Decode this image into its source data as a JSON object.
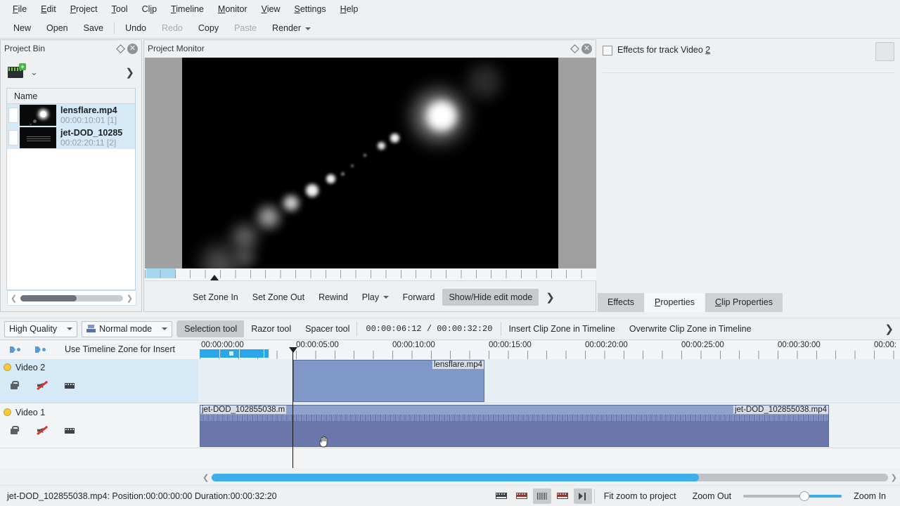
{
  "menubar": {
    "items": [
      {
        "label": "File",
        "accel": "F"
      },
      {
        "label": "Edit",
        "accel": "E"
      },
      {
        "label": "Project",
        "accel": "P"
      },
      {
        "label": "Tool",
        "accel": "T"
      },
      {
        "label": "Clip",
        "accel": "i"
      },
      {
        "label": "Timeline",
        "accel": "T"
      },
      {
        "label": "Monitor",
        "accel": "M"
      },
      {
        "label": "View",
        "accel": "V"
      },
      {
        "label": "Settings",
        "accel": "S"
      },
      {
        "label": "Help",
        "accel": "H"
      }
    ]
  },
  "toolbar": {
    "new_label": "New",
    "open_label": "Open",
    "save_label": "Save",
    "undo_label": "Undo",
    "redo_label": "Redo",
    "copy_label": "Copy",
    "paste_label": "Paste",
    "render_label": "Render"
  },
  "project_bin": {
    "title": "Project Bin",
    "column_header": "Name",
    "items": [
      {
        "name": "lensflare.mp4",
        "duration": "00:00:10:01 [1]"
      },
      {
        "name": "jet-DOD_10285",
        "duration": "00:02:20:11 [2]"
      }
    ]
  },
  "monitor": {
    "title": "Project Monitor",
    "buttons": [
      {
        "label": "Set Zone In",
        "pressed": false
      },
      {
        "label": "Set Zone Out",
        "pressed": false
      },
      {
        "label": "Rewind",
        "pressed": false
      },
      {
        "label": "Play",
        "pressed": false
      },
      {
        "label": "Forward",
        "pressed": false
      },
      {
        "label": "Show/Hide edit mode",
        "pressed": true
      }
    ]
  },
  "effects_panel": {
    "header": "Effects for track Video 2",
    "tabs": [
      {
        "label": "Effects",
        "active": false
      },
      {
        "label": "Properties",
        "active": true
      },
      {
        "label": "Clip Properties",
        "active": false
      }
    ]
  },
  "timeline_toolbar": {
    "quality": "High Quality",
    "mode": "Normal mode",
    "tools": [
      {
        "label": "Selection tool",
        "pressed": true
      },
      {
        "label": "Razor tool",
        "pressed": false
      },
      {
        "label": "Spacer tool",
        "pressed": false
      }
    ],
    "position_timecode": "00:00:06:12",
    "duration_timecode": "00:00:32:20",
    "timecode_separator": "/",
    "insert_label": "Insert Clip Zone in Timeline",
    "overwrite_label": "Overwrite Clip Zone in Timeline"
  },
  "timeline": {
    "zone_insert_label": "Use Timeline Zone for Insert",
    "ruler_labels": [
      "00:00:00:00",
      "00:00:05:00",
      "00:00:10:00",
      "00:00:15:00",
      "00:00:20:00",
      "00:00:25:00",
      "00:00:30:00",
      "00:00:"
    ],
    "tracks": [
      {
        "name": "Video 2",
        "selected": true
      },
      {
        "name": "Video 1",
        "selected": false
      }
    ],
    "clips": [
      {
        "track": "Video 2",
        "label": "lensflare.mp4",
        "align": "right"
      },
      {
        "track": "Video 1",
        "label_left": "jet-DOD_102855038.m",
        "label_right": "jet-DOD_102855038.mp4"
      }
    ]
  },
  "status": {
    "text": "jet-DOD_102855038.mp4: Position:00:00:00:00 Duration:00:00:32:20",
    "fit_zoom_label": "Fit zoom to project",
    "zoom_out_label": "Zoom Out",
    "zoom_in_label": "Zoom In"
  },
  "colors": {
    "accent": "#3daee9",
    "window": "#eff0f1",
    "selection": "#d6e9f7",
    "clip_v2": "#8098c8",
    "clip_v1": "#8fa2cd",
    "waveform": "#6b77ab"
  }
}
